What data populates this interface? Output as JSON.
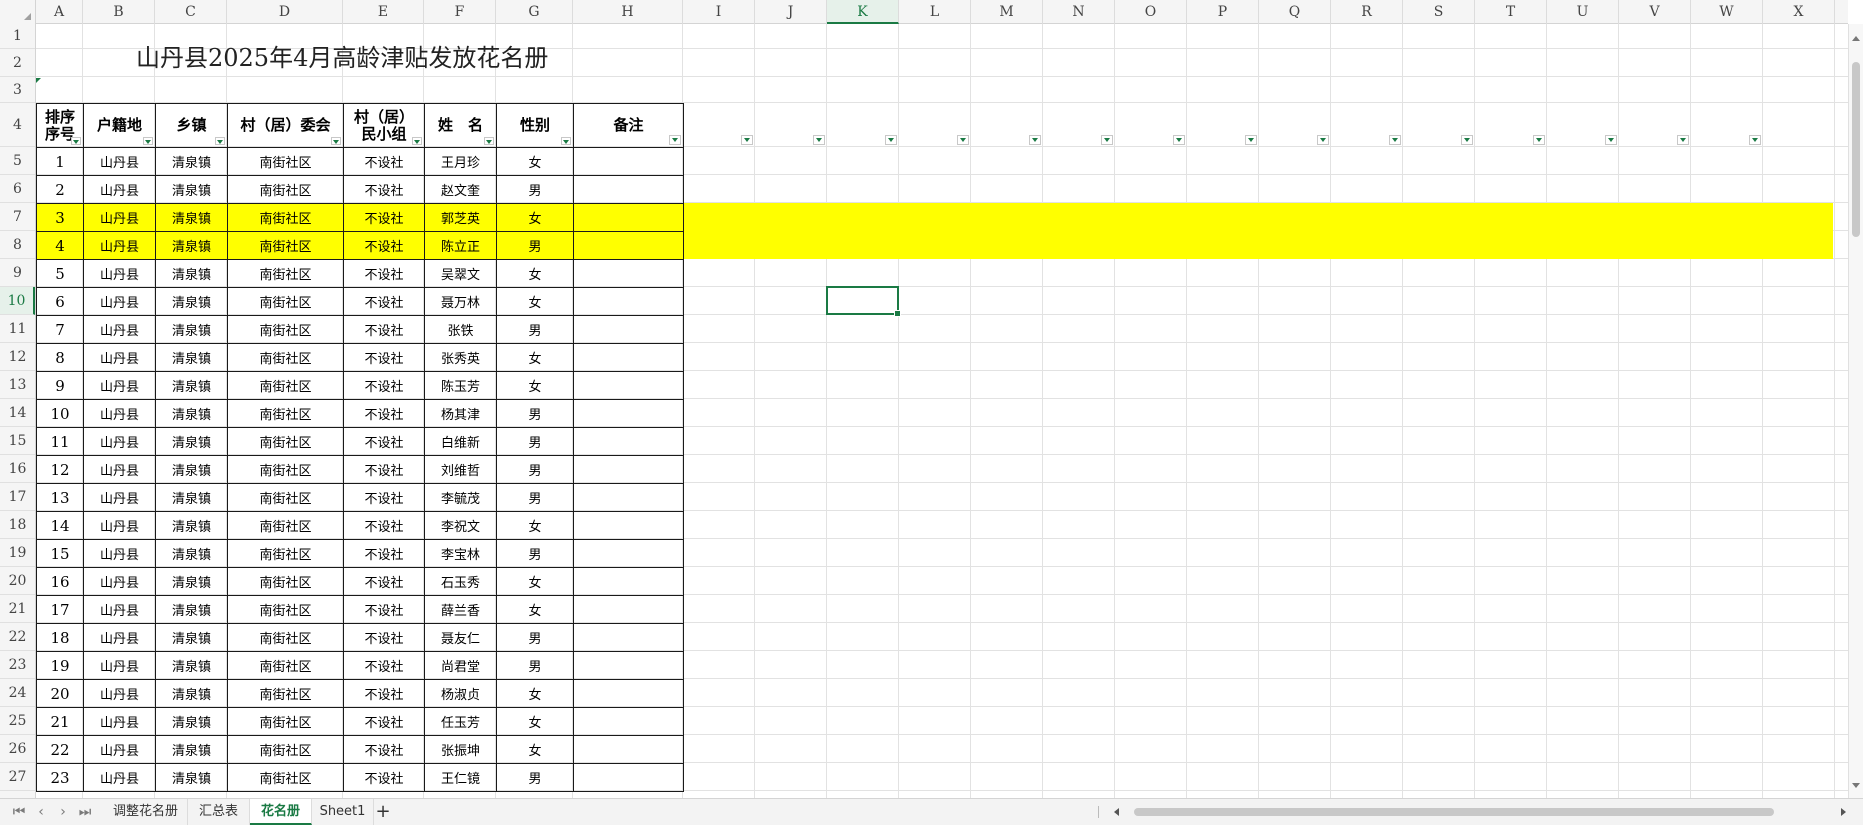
{
  "sheet": {
    "columns": [
      "A",
      "B",
      "C",
      "D",
      "E",
      "F",
      "G",
      "H",
      "I",
      "J",
      "K",
      "L",
      "M",
      "N",
      "O",
      "P",
      "Q",
      "R",
      "S",
      "T",
      "U",
      "V",
      "W",
      "X"
    ],
    "active_column": "K",
    "active_row": "10",
    "rows": [
      "1",
      "2",
      "3",
      "4",
      "5",
      "6",
      "7",
      "8",
      "9",
      "10",
      "11",
      "12",
      "13",
      "14",
      "15",
      "16",
      "17",
      "18",
      "19",
      "20",
      "21",
      "22",
      "23",
      "24",
      "25",
      "26",
      "27"
    ],
    "title": "山丹县2025年4月高龄津贴发放花名册",
    "headers": {
      "seq": "排序\n序号",
      "hukou": "户籍地",
      "town": "乡镇",
      "committee": "村（居）委会",
      "group": "村（居）\n民小组",
      "name": "姓　名",
      "gender": "性别",
      "remark": "备注"
    },
    "records": [
      {
        "seq": "1",
        "hukou": "山丹县",
        "town": "清泉镇",
        "committee": "南街社区",
        "group": "不设社",
        "name": "王月珍",
        "gender": "女",
        "remark": "",
        "highlight": false
      },
      {
        "seq": "2",
        "hukou": "山丹县",
        "town": "清泉镇",
        "committee": "南街社区",
        "group": "不设社",
        "name": "赵文奎",
        "gender": "男",
        "remark": "",
        "highlight": false
      },
      {
        "seq": "3",
        "hukou": "山丹县",
        "town": "清泉镇",
        "committee": "南街社区",
        "group": "不设社",
        "name": "郭芝英",
        "gender": "女",
        "remark": "",
        "highlight": true
      },
      {
        "seq": "4",
        "hukou": "山丹县",
        "town": "清泉镇",
        "committee": "南街社区",
        "group": "不设社",
        "name": "陈立正",
        "gender": "男",
        "remark": "",
        "highlight": true
      },
      {
        "seq": "5",
        "hukou": "山丹县",
        "town": "清泉镇",
        "committee": "南街社区",
        "group": "不设社",
        "name": "吴翠文",
        "gender": "女",
        "remark": "",
        "highlight": false
      },
      {
        "seq": "6",
        "hukou": "山丹县",
        "town": "清泉镇",
        "committee": "南街社区",
        "group": "不设社",
        "name": "聂万林",
        "gender": "女",
        "remark": "",
        "highlight": false
      },
      {
        "seq": "7",
        "hukou": "山丹县",
        "town": "清泉镇",
        "committee": "南街社区",
        "group": "不设社",
        "name": "张铁",
        "gender": "男",
        "remark": "",
        "highlight": false
      },
      {
        "seq": "8",
        "hukou": "山丹县",
        "town": "清泉镇",
        "committee": "南街社区",
        "group": "不设社",
        "name": "张秀英",
        "gender": "女",
        "remark": "",
        "highlight": false
      },
      {
        "seq": "9",
        "hukou": "山丹县",
        "town": "清泉镇",
        "committee": "南街社区",
        "group": "不设社",
        "name": "陈玉芳",
        "gender": "女",
        "remark": "",
        "highlight": false
      },
      {
        "seq": "10",
        "hukou": "山丹县",
        "town": "清泉镇",
        "committee": "南街社区",
        "group": "不设社",
        "name": "杨其津",
        "gender": "男",
        "remark": "",
        "highlight": false
      },
      {
        "seq": "11",
        "hukou": "山丹县",
        "town": "清泉镇",
        "committee": "南街社区",
        "group": "不设社",
        "name": "白维新",
        "gender": "男",
        "remark": "",
        "highlight": false
      },
      {
        "seq": "12",
        "hukou": "山丹县",
        "town": "清泉镇",
        "committee": "南街社区",
        "group": "不设社",
        "name": "刘维哲",
        "gender": "男",
        "remark": "",
        "highlight": false
      },
      {
        "seq": "13",
        "hukou": "山丹县",
        "town": "清泉镇",
        "committee": "南街社区",
        "group": "不设社",
        "name": "李毓茂",
        "gender": "男",
        "remark": "",
        "highlight": false
      },
      {
        "seq": "14",
        "hukou": "山丹县",
        "town": "清泉镇",
        "committee": "南街社区",
        "group": "不设社",
        "name": "李祝文",
        "gender": "女",
        "remark": "",
        "highlight": false
      },
      {
        "seq": "15",
        "hukou": "山丹县",
        "town": "清泉镇",
        "committee": "南街社区",
        "group": "不设社",
        "name": "李宝林",
        "gender": "男",
        "remark": "",
        "highlight": false
      },
      {
        "seq": "16",
        "hukou": "山丹县",
        "town": "清泉镇",
        "committee": "南街社区",
        "group": "不设社",
        "name": "石玉秀",
        "gender": "女",
        "remark": "",
        "highlight": false
      },
      {
        "seq": "17",
        "hukou": "山丹县",
        "town": "清泉镇",
        "committee": "南街社区",
        "group": "不设社",
        "name": "薛兰香",
        "gender": "女",
        "remark": "",
        "highlight": false
      },
      {
        "seq": "18",
        "hukou": "山丹县",
        "town": "清泉镇",
        "committee": "南街社区",
        "group": "不设社",
        "name": "聂友仁",
        "gender": "男",
        "remark": "",
        "highlight": false
      },
      {
        "seq": "19",
        "hukou": "山丹县",
        "town": "清泉镇",
        "committee": "南街社区",
        "group": "不设社",
        "name": "尚君堂",
        "gender": "男",
        "remark": "",
        "highlight": false
      },
      {
        "seq": "20",
        "hukou": "山丹县",
        "town": "清泉镇",
        "committee": "南街社区",
        "group": "不设社",
        "name": "杨淑贞",
        "gender": "女",
        "remark": "",
        "highlight": false
      },
      {
        "seq": "21",
        "hukou": "山丹县",
        "town": "清泉镇",
        "committee": "南街社区",
        "group": "不设社",
        "name": "任玉芳",
        "gender": "女",
        "remark": "",
        "highlight": false
      },
      {
        "seq": "22",
        "hukou": "山丹县",
        "town": "清泉镇",
        "committee": "南街社区",
        "group": "不设社",
        "name": "张振坤",
        "gender": "女",
        "remark": "",
        "highlight": false
      },
      {
        "seq": "23",
        "hukou": "山丹县",
        "town": "清泉镇",
        "committee": "南街社区",
        "group": "不设社",
        "name": "王仁镜",
        "gender": "男",
        "remark": "",
        "highlight": false
      }
    ]
  },
  "tabs": [
    {
      "label": "调整花名册",
      "active": false
    },
    {
      "label": "汇总表",
      "active": false
    },
    {
      "label": "花名册",
      "active": true
    },
    {
      "label": "Sheet1",
      "active": false
    }
  ],
  "add_sheet_label": "+",
  "nav_icons": [
    "first-sheet-icon",
    "prev-sheet-icon",
    "next-sheet-icon",
    "last-sheet-icon"
  ],
  "colors": {
    "highlight": "#ffff00",
    "accent": "#1a7a44"
  }
}
